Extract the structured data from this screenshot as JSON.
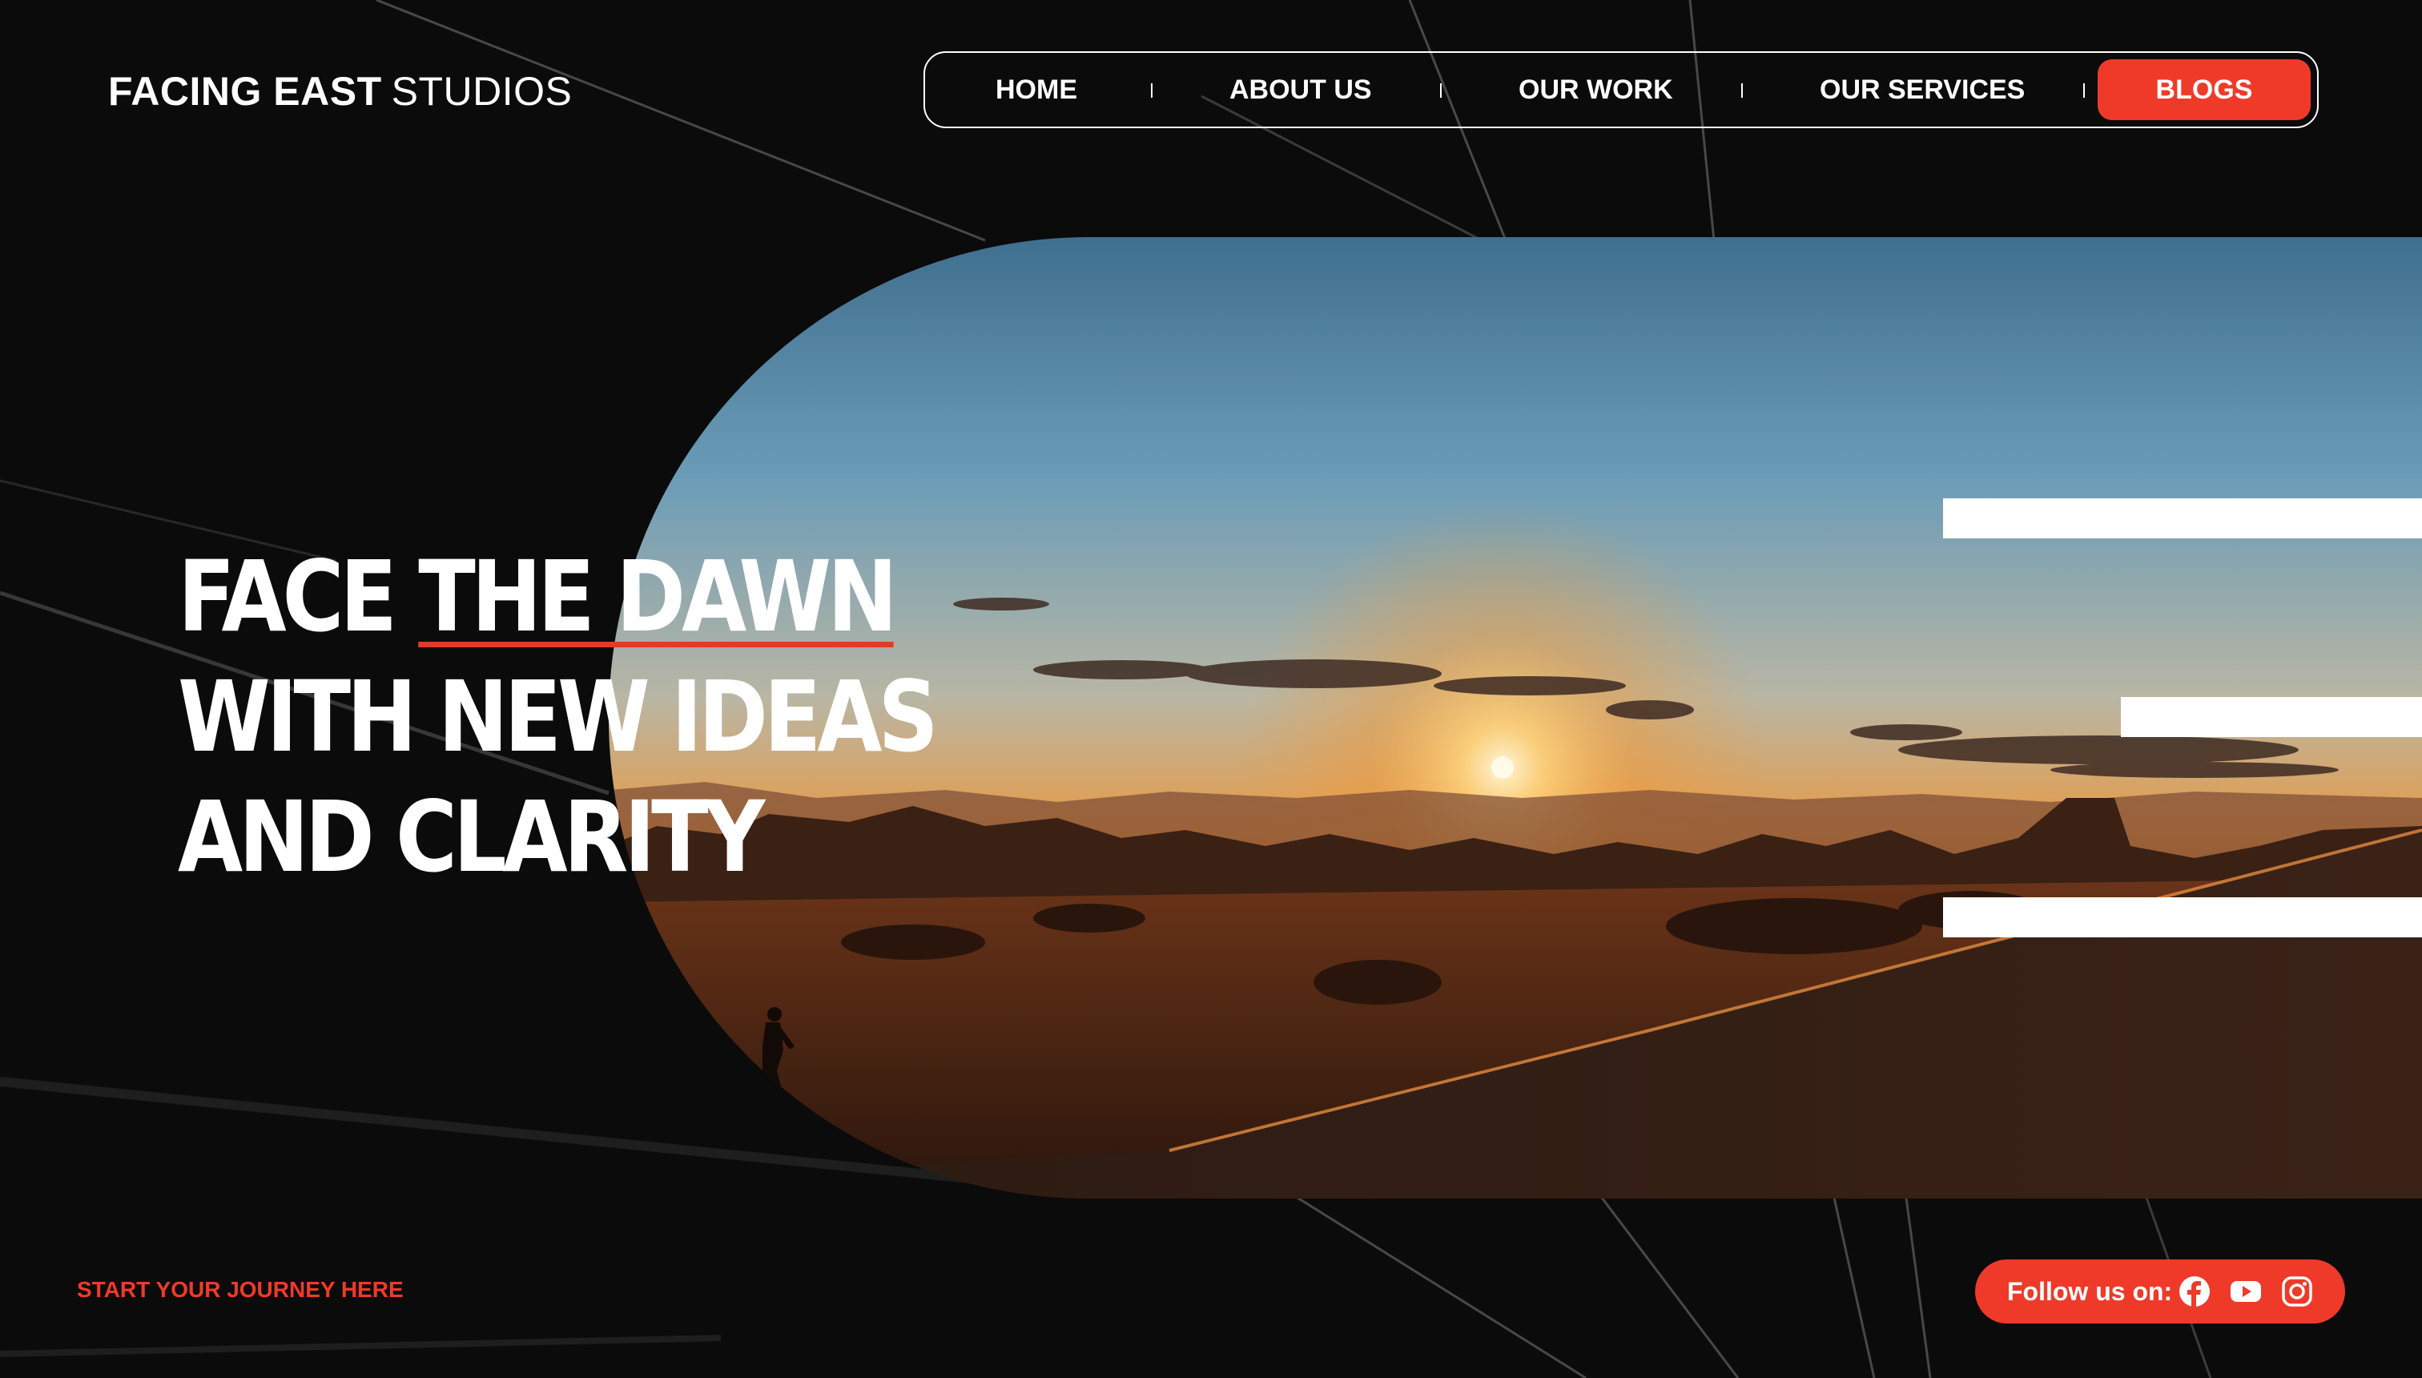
{
  "brand": {
    "name_bold": "FACING EAST",
    "name_light": "STUDIOS"
  },
  "nav": {
    "items": [
      {
        "label": "HOME"
      },
      {
        "label": "ABOUT US"
      },
      {
        "label": "OUR WORK"
      },
      {
        "label": "OUR SERVICES"
      }
    ],
    "cta_label": "BLOGS"
  },
  "hero": {
    "headline": {
      "line1_part1": "FACE ",
      "line1_highlight": "THE DAWN",
      "line2": "WITH NEW IDEAS",
      "line3": "AND CLARITY"
    }
  },
  "footer": {
    "journey_link": "START YOUR JOURNEY HERE",
    "follow_label": "Follow us on:",
    "socials": [
      "facebook-icon",
      "youtube-icon",
      "instagram-icon"
    ]
  },
  "colors": {
    "accent": "#ef3a2a",
    "background": "#0b0b0b",
    "text": "#ffffff"
  }
}
